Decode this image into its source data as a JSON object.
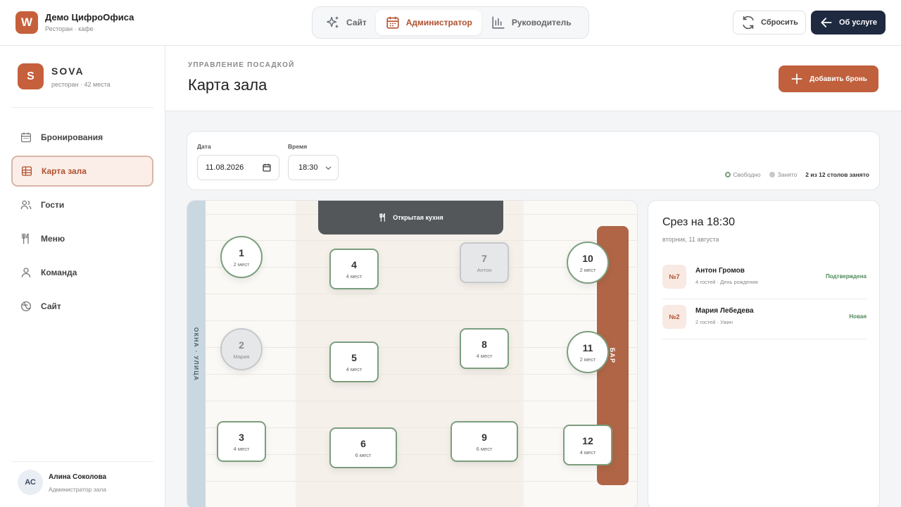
{
  "app": {
    "logo_letter": "W",
    "title": "Демо ЦифроОфиса",
    "subtitle": "Ресторан · кафе"
  },
  "modes": [
    {
      "label": "Сайт",
      "icon": "sparkles-icon",
      "active": false
    },
    {
      "label": "Администратор",
      "icon": "calendar-icon",
      "active": true
    },
    {
      "label": "Руководитель",
      "icon": "bar-chart-icon",
      "active": false
    }
  ],
  "topbar": {
    "reset_label": "Сбросить",
    "about_label": "Об услуге"
  },
  "venue": {
    "letter": "S",
    "name": "SOVA",
    "subtitle": "ресторан · 42 места"
  },
  "nav": [
    {
      "label": "Бронирования",
      "icon": "calendar-icon",
      "active": false
    },
    {
      "label": "Карта зала",
      "icon": "floor-map-icon",
      "active": true
    },
    {
      "label": "Гости",
      "icon": "guests-icon",
      "active": false
    },
    {
      "label": "Меню",
      "icon": "cutlery-icon",
      "active": false
    },
    {
      "label": "Команда",
      "icon": "user-icon",
      "active": false
    },
    {
      "label": "Сайт",
      "icon": "globe-icon",
      "active": false
    }
  ],
  "user": {
    "initials": "АС",
    "name": "Алина Соколова",
    "role": "Администратор зала"
  },
  "header": {
    "eyebrow": "УПРАВЛЕНИЕ ПОСАДКОЙ",
    "title": "Карта зала",
    "add_label": "Добавить бронь"
  },
  "filters": {
    "date_label": "Дата",
    "date_value": "11.08.2026",
    "time_label": "Время",
    "time_value": "18:30",
    "legend_free": "Свободно",
    "legend_busy": "Занято",
    "occupancy": "2 из 12 столов занято"
  },
  "colors": {
    "accent": "#c0603d",
    "free": "#7c9e7e",
    "busy": "#c6c8cb",
    "dark": "#1f2940"
  },
  "floor": {
    "kitchen_label": "Открытая кухня",
    "window_label": "ОКНА · УЛИЦА",
    "bar_label": "БАР",
    "tables": [
      {
        "num": "1",
        "sub": "2 мест",
        "shape": "round",
        "busy": false
      },
      {
        "num": "2",
        "sub": "Мария",
        "shape": "round",
        "busy": true
      },
      {
        "num": "3",
        "sub": "4 мест",
        "shape": "rect",
        "busy": false
      },
      {
        "num": "4",
        "sub": "4 мест",
        "shape": "rect",
        "busy": false
      },
      {
        "num": "5",
        "sub": "4 мест",
        "shape": "rect",
        "busy": false
      },
      {
        "num": "6",
        "sub": "6 мест",
        "shape": "rect",
        "busy": false
      },
      {
        "num": "7",
        "sub": "Антон",
        "shape": "rect",
        "busy": true
      },
      {
        "num": "8",
        "sub": "4 мест",
        "shape": "rect",
        "busy": false
      },
      {
        "num": "9",
        "sub": "6 мест",
        "shape": "rect",
        "busy": false
      },
      {
        "num": "10",
        "sub": "2 мест",
        "shape": "round",
        "busy": false
      },
      {
        "num": "11",
        "sub": "2 мест",
        "shape": "round",
        "busy": false
      },
      {
        "num": "12",
        "sub": "4 мест",
        "shape": "rect",
        "busy": false
      }
    ]
  },
  "snapshot": {
    "title": "Срез на 18:30",
    "date": "вторник, 11 августа",
    "bookings": [
      {
        "table": "№7",
        "name": "Антон Громов",
        "meta": "4 гостей · День рождения",
        "status": "Подтверждена"
      },
      {
        "table": "№2",
        "name": "Мария Лебедева",
        "meta": "2 гостей · Ужин",
        "status": "Новая"
      }
    ]
  }
}
